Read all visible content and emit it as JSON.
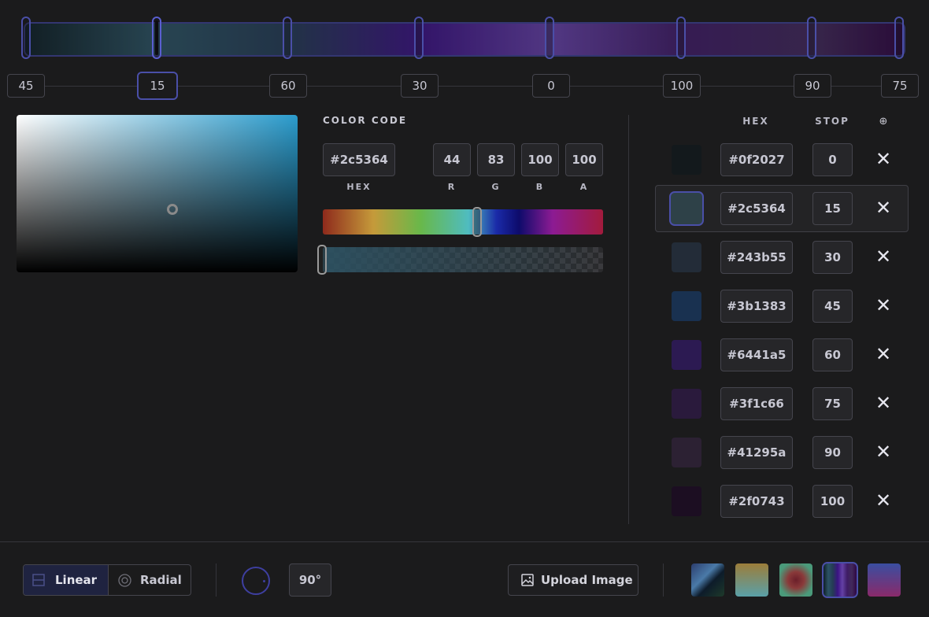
{
  "gradient": {
    "stops": [
      {
        "hex": "#0f2027",
        "position": 0
      },
      {
        "hex": "#2c5364",
        "position": 15
      },
      {
        "hex": "#243b55",
        "position": 30
      },
      {
        "hex": "#3b1383",
        "position": 45
      },
      {
        "hex": "#6441a5",
        "position": 60
      },
      {
        "hex": "#3f1c66",
        "position": 75
      },
      {
        "hex": "#41295a",
        "position": 90
      },
      {
        "hex": "#2f0743",
        "position": 100
      }
    ],
    "active_index": 1
  },
  "stop_labels": [
    "45",
    "15",
    "60",
    "30",
    "0",
    "100",
    "90",
    "75"
  ],
  "picker": {
    "section_title": "COLOR CODE",
    "hex_value": "#2c5364",
    "hex_label": "HEX",
    "r": "44",
    "g": "83",
    "b": "100",
    "a": "100",
    "r_label": "R",
    "g_label": "G",
    "b_label": "B",
    "a_label": "A"
  },
  "list_header": {
    "hex": "HEX",
    "stop": "STOP",
    "add_icon": "⊕"
  },
  "stops_list": [
    {
      "hex": "#0f2027",
      "stop": "0",
      "color": "#13191c"
    },
    {
      "hex": "#2c5364",
      "stop": "15",
      "color": "#2e4148"
    },
    {
      "hex": "#243b55",
      "stop": "30",
      "color": "#232c38"
    },
    {
      "hex": "#3b1383",
      "stop": "45",
      "color": "#193150"
    },
    {
      "hex": "#6441a5",
      "stop": "60",
      "color": "#2c1a52"
    },
    {
      "hex": "#3f1c66",
      "stop": "75",
      "color": "#2a1a3c"
    },
    {
      "hex": "#41295a",
      "stop": "90",
      "color": "#2c2133"
    },
    {
      "hex": "#2f0743",
      "stop": "100",
      "color": "#1c0e22"
    }
  ],
  "toolbar": {
    "linear_label": "Linear",
    "radial_label": "Radial",
    "angle": "90°",
    "upload_label": "Upload Image",
    "presets": [
      "preset-1",
      "preset-2",
      "preset-3",
      "preset-4",
      "preset-5"
    ],
    "active_preset": 3
  }
}
